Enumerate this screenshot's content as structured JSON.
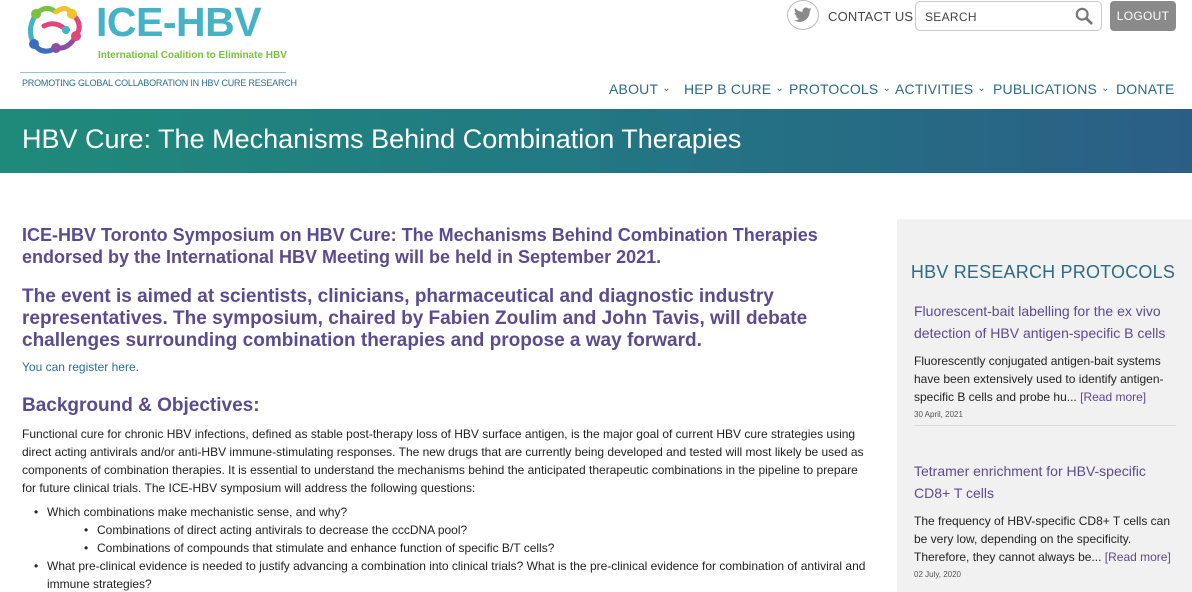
{
  "logo": {
    "title": "ICE-HBV",
    "subtitle": "International Coalition to Eliminate HBV",
    "tagline": "PROMOTING GLOBAL COLLABORATION IN HBV CURE RESEARCH"
  },
  "header": {
    "contact_label": "CONTACT US",
    "search_placeholder": "SEARCH",
    "logout_label": "LOGOUT",
    "nav": [
      {
        "label": "ABOUT",
        "dropdown": true
      },
      {
        "label": "HEP B CURE",
        "dropdown": true
      },
      {
        "label": "PROTOCOLS",
        "dropdown": true
      },
      {
        "label": "ACTIVITIES",
        "dropdown": true
      },
      {
        "label": "PUBLICATIONS",
        "dropdown": true
      },
      {
        "label": "DONATE",
        "dropdown": false
      }
    ]
  },
  "banner": {
    "title": "HBV Cure: The Mechanisms Behind Combination Therapies"
  },
  "main": {
    "lead1": "ICE-HBV Toronto Symposium on HBV Cure: The Mechanisms Behind Combination Therapies endorsed by the International HBV Meeting will be held in September 2021.",
    "lead2": "The event is aimed at scientists, clinicians, pharmaceutical and diagnostic industry representatives. The symposium, chaired by Fabien Zoulim and John Tavis, will debate challenges surrounding combination therapies and propose a way forward.",
    "register_link": "You can register here.",
    "background_heading": "Background & Objectives:",
    "background_text": "Functional cure for chronic HBV infections, defined as stable post-therapy loss of HBV surface antigen, is the major goal of current HBV cure strategies using direct acting antivirals and/or anti-HBV immune-stimulating responses. The new drugs that are currently being developed and tested will most likely be used as components of combination therapies. It is essential to understand the mechanisms behind the anticipated therapeutic combinations in the pipeline to prepare for future clinical trials. The ICE-HBV symposium will address the following questions:",
    "q1": "Which combinations make mechanistic sense, and why?",
    "q1a": "Combinations of direct acting antivirals to decrease the cccDNA pool?",
    "q1b": "Combinations of compounds that stimulate and enhance function of specific B/T cells?",
    "q2": "What pre-clinical evidence is needed to justify advancing a combination into clinical trials? What is the pre-clinical evidence for combination of antiviral and immune strategies?"
  },
  "sidebar": {
    "title": "HBV RESEARCH PROTOCOLS",
    "cards": [
      {
        "title": "Fluorescent-bait labelling for the ex vivo detection of HBV antigen-specific B cells",
        "text": "Fluorescently conjugated antigen-bait systems have been extensively used to identify antigen-specific B cells and probe hu...",
        "more": "[Read more]",
        "date": "30 April, 2021"
      },
      {
        "title": "Tetramer enrichment for HBV-specific CD8+ T cells",
        "text": "The frequency of HBV-specific CD8+ T cells can be very low, depending on the specificity. Therefore, they cannot always be...",
        "more": "[Read more]",
        "date": "02 July, 2020"
      }
    ]
  },
  "colors": {
    "brand_teal": "#46b2c6",
    "brand_green": "#7ac043",
    "heading_purple": "#5b4b8f",
    "nav_blue": "#2e6b86",
    "banner_start": "#1f8a7a",
    "banner_end": "#2b5e86",
    "logout_bg": "#8a8a8a"
  },
  "icons": [
    "logo-mark-icon",
    "twitter-icon",
    "search-icon",
    "chevron-down-icon"
  ]
}
